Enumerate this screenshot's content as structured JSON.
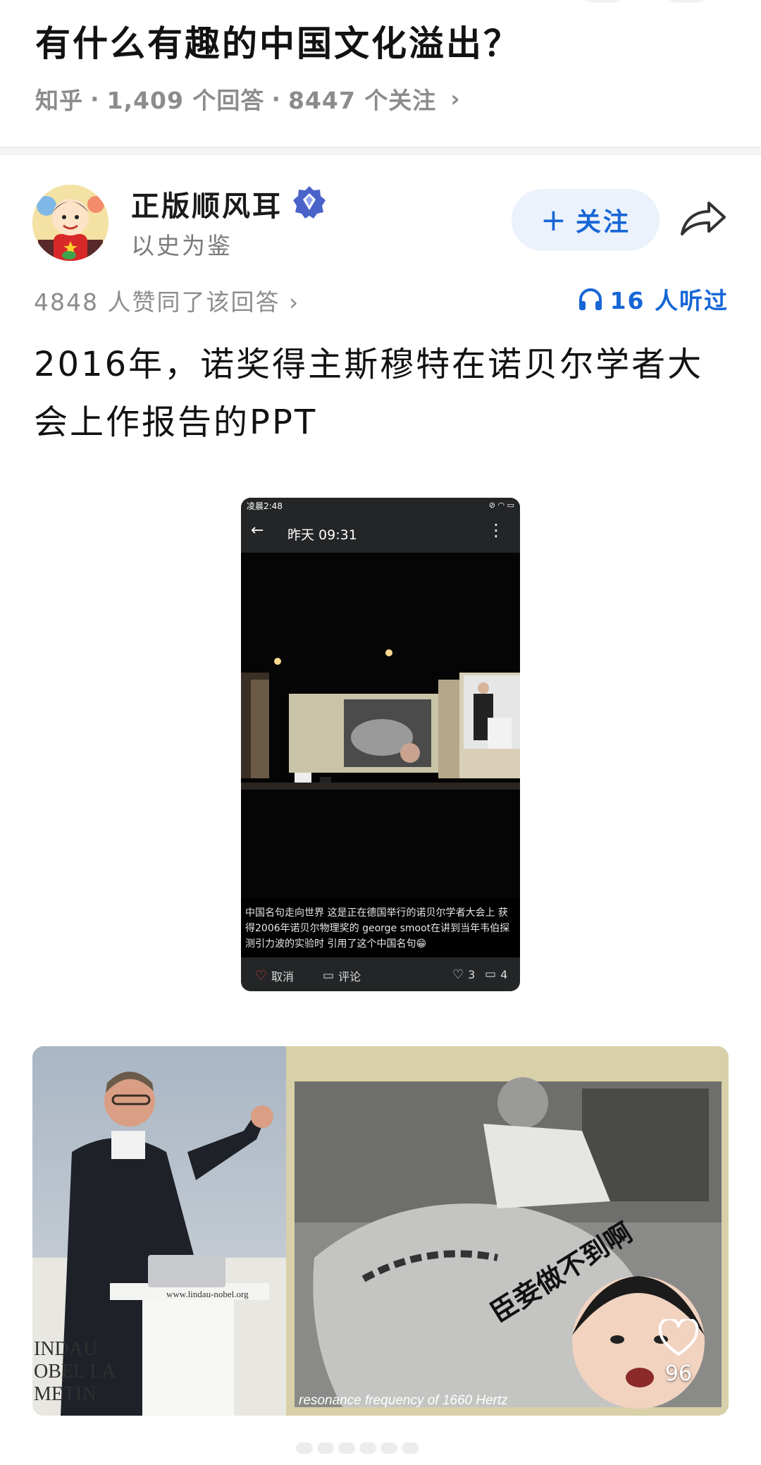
{
  "question": {
    "title": "有什么有趣的中国文化溢出？",
    "source": "知乎",
    "answers": "1,409 个回答",
    "followers": "8447 个关注",
    "sep": "·"
  },
  "author": {
    "name": "正版顺风耳",
    "bio": "以史为鉴",
    "follow_label": "关注",
    "follow_plus": "+"
  },
  "stats": {
    "agree": "4848 人赞同了该回答",
    "listened": "16 人听过"
  },
  "answer": {
    "text": "2016年，诺奖得主斯穆特在诺贝尔学者大会上作报告的PPT"
  },
  "phone_screenshot": {
    "status_time": "凌晨2:48",
    "title_time": "昨天 09:31",
    "caption": "中国名句走向世界 这是正在德国举行的诺贝尔学者大会上 获得2006年诺贝尔物理奖的 george smoot在讲到当年韦伯探测引力波的实验时 引用了这个中国名句😁",
    "cancel_label": "取消",
    "comment_label": "评论",
    "likes": "3",
    "comments": "4"
  },
  "photo": {
    "podium_text": "www.lindau-nobel.org",
    "banner_text_1": "INDAU",
    "banner_text_2": "OBEL LA",
    "banner_text_3": "METIN",
    "caption_overlay": "臣妾做不到啊",
    "footer_text": "resonance frequency of 1660 Hertz",
    "like_count": "96"
  },
  "colors": {
    "accent": "#1766d6",
    "follow_bg": "#ebf2fc",
    "muted": "#8c8c8c"
  }
}
